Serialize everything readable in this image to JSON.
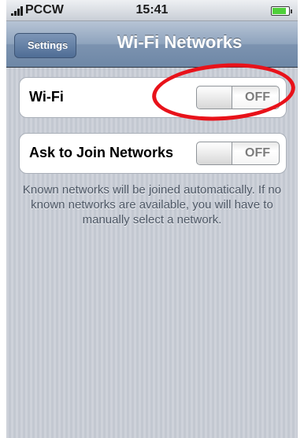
{
  "status_bar": {
    "carrier": "PCCW",
    "time": "15:41",
    "battery_level": 0.85
  },
  "nav_bar": {
    "back_label": "Settings",
    "title": "Wi-Fi Networks"
  },
  "settings": {
    "wifi": {
      "label": "Wi-Fi",
      "state": "OFF"
    },
    "ask_to_join": {
      "label": "Ask to Join Networks",
      "state": "OFF"
    }
  },
  "info_text": "Known networks will be joined automatically. If no known networks are available, you will have to manually select a network.",
  "colors": {
    "annotation": "#e8121a",
    "nav_bar": "#7c93b0",
    "background": "#c7ccd5"
  }
}
